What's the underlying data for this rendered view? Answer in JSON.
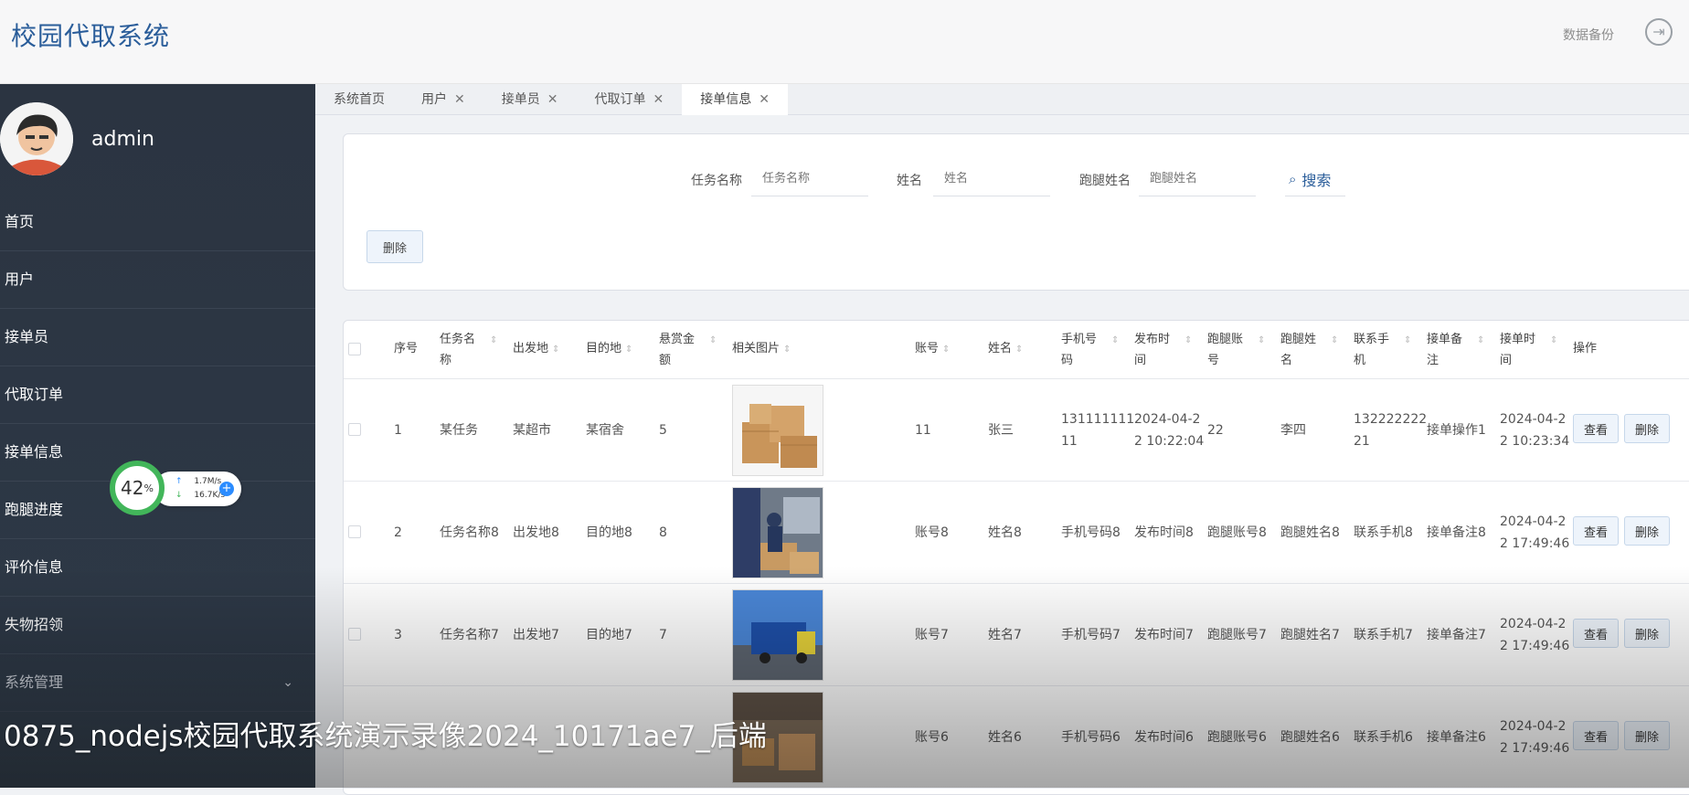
{
  "header": {
    "brand": "校园代取系统",
    "backup_label": "数据备份",
    "logout_icon": "logout-icon"
  },
  "sidebar": {
    "username": "admin",
    "items": [
      {
        "label": "首页"
      },
      {
        "label": "用户"
      },
      {
        "label": "接单员"
      },
      {
        "label": "代取订单"
      },
      {
        "label": "接单信息"
      },
      {
        "label": "跑腿进度"
      },
      {
        "label": "评价信息"
      },
      {
        "label": "失物招领"
      },
      {
        "label": "系统管理"
      }
    ]
  },
  "tabs": [
    {
      "label": "系统首页",
      "closable": false
    },
    {
      "label": "用户",
      "closable": true
    },
    {
      "label": "接单员",
      "closable": true
    },
    {
      "label": "代取订单",
      "closable": true
    },
    {
      "label": "接单信息",
      "closable": true,
      "active": true
    }
  ],
  "search": {
    "task_label": "任务名称",
    "task_placeholder": "任务名称",
    "name_label": "姓名",
    "name_placeholder": "姓名",
    "runner_label": "跑腿姓名",
    "runner_placeholder": "跑腿姓名",
    "search_button": "搜索",
    "delete_button": "删除"
  },
  "table": {
    "headers": {
      "index": "序号",
      "task_name_1": "任务名",
      "task_name_2": "称",
      "origin": "出发地",
      "destination": "目的地",
      "reward_1": "悬赏金",
      "reward_2": "额",
      "image": "相关图片",
      "account": "账号",
      "name": "姓名",
      "phone_1": "手机号",
      "phone_2": "码",
      "publish_time_1": "发布时",
      "publish_time_2": "间",
      "runner_account_1": "跑腿账",
      "runner_account_2": "号",
      "runner_name_1": "跑腿姓",
      "runner_name_2": "名",
      "contact_1": "联系手",
      "contact_2": "机",
      "remark_1": "接单备",
      "remark_2": "注",
      "accept_time_1": "接单时",
      "accept_time_2": "间",
      "ops": "操作"
    },
    "rows": [
      {
        "index": "1",
        "task": "某任务",
        "origin": "某超市",
        "destination": "某宿舍",
        "reward": "5",
        "image": "cardboard-boxes-image",
        "account": "11",
        "name": "张三",
        "phone_1": "131111111",
        "phone_2": "11",
        "publish_1": "2024-04-2",
        "publish_2": "2 10:22:04",
        "runner_account": "22",
        "runner_name": "李四",
        "contact_1": "132222222",
        "contact_2": "21",
        "remark": "接单操作1",
        "accept_1": "2024-04-2",
        "accept_2": "2 10:23:34",
        "view": "查看",
        "delete": "删除"
      },
      {
        "index": "2",
        "task": "任务名称8",
        "origin": "出发地8",
        "destination": "目的地8",
        "reward": "8",
        "image": "couriers-packages-image",
        "account": "账号8",
        "name": "姓名8",
        "phone_1": "手机号码8",
        "phone_2": "",
        "publish_1": "发布时间8",
        "publish_2": "",
        "runner_account": "跑腿账号8",
        "runner_name": "跑腿姓名8",
        "contact_1": "联系手机8",
        "contact_2": "",
        "remark": "接单备注8",
        "accept_1": "2024-04-2",
        "accept_2": "2 17:49:46",
        "view": "查看",
        "delete": "删除"
      },
      {
        "index": "3",
        "task": "任务名称7",
        "origin": "出发地7",
        "destination": "目的地7",
        "reward": "7",
        "image": "delivery-truck-image",
        "account": "账号7",
        "name": "姓名7",
        "phone_1": "手机号码7",
        "phone_2": "",
        "publish_1": "发布时间7",
        "publish_2": "",
        "runner_account": "跑腿账号7",
        "runner_name": "跑腿姓名7",
        "contact_1": "联系手机7",
        "contact_2": "",
        "remark": "接单备注7",
        "accept_1": "2024-04-2",
        "accept_2": "2 17:49:46",
        "view": "查看",
        "delete": "删除"
      },
      {
        "index": "",
        "task": "",
        "origin": "",
        "destination": "",
        "reward": "",
        "image": "parcels-street-image",
        "account": "账号6",
        "name": "姓名6",
        "phone_1": "手机号码6",
        "phone_2": "",
        "publish_1": "发布时间6",
        "publish_2": "",
        "runner_account": "跑腿账号6",
        "runner_name": "跑腿姓名6",
        "contact_1": "联系手机6",
        "contact_2": "",
        "remark": "接单备注6",
        "accept_1": "2024-04-2",
        "accept_2": "2 17:49:46",
        "view": "查看",
        "delete": "删除"
      }
    ]
  },
  "widget": {
    "percent": "42",
    "percent_sign": "%",
    "up_speed": "1.7M/s",
    "down_speed": "16.7K/s"
  },
  "caption": "0875_nodejs校园代取系统演示录像2024_10171ae7_后端",
  "colors": {
    "brand": "#2a5d9a",
    "sidebar": "#2b3441",
    "widget_ring": "#42b65a",
    "widget_plus": "#2b8cff"
  }
}
